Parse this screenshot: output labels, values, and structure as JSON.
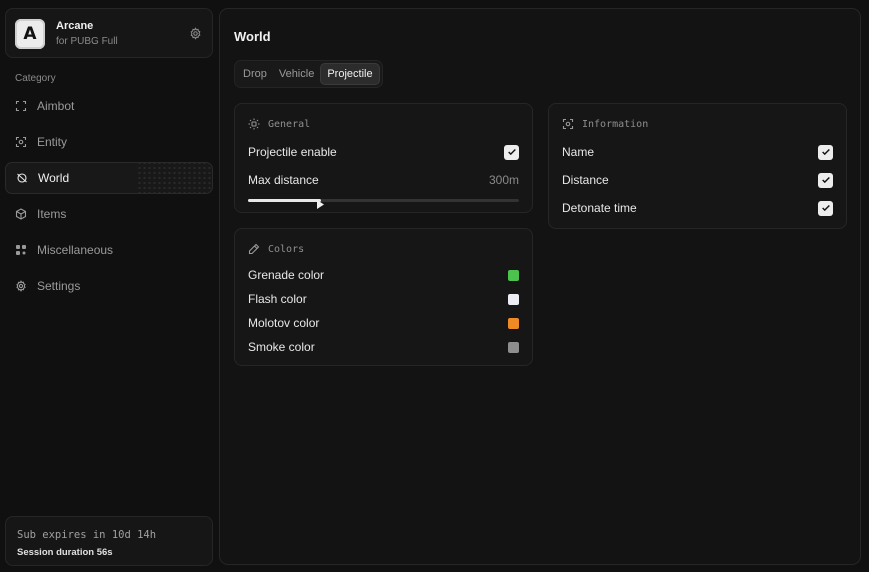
{
  "brand": {
    "logo_letter": "A",
    "name": "Arcane",
    "subtitle": "for PUBG Full",
    "icon": "gear-icon"
  },
  "sidebar": {
    "category_label": "Category",
    "items": [
      {
        "label": "Aimbot",
        "icon": "crosshair-icon",
        "active": false
      },
      {
        "label": "Entity",
        "icon": "scan-icon",
        "active": false
      },
      {
        "label": "World",
        "icon": "globe-icon",
        "active": true
      },
      {
        "label": "Items",
        "icon": "cube-icon",
        "active": false
      },
      {
        "label": "Miscellaneous",
        "icon": "grid-icon",
        "active": false
      },
      {
        "label": "Settings",
        "icon": "gear-icon",
        "active": false
      }
    ],
    "subscription": {
      "expires": "Sub expires in 10d 14h",
      "session": "Session duration 56s"
    }
  },
  "main": {
    "title": "World",
    "tabs": [
      {
        "label": "Drop",
        "active": false
      },
      {
        "label": "Vehicle",
        "active": false
      },
      {
        "label": "Projectile",
        "active": true
      }
    ],
    "general": {
      "header": "General",
      "projectile_enable": {
        "label": "Projectile enable",
        "checked": true
      },
      "max_distance": {
        "label": "Max distance",
        "value_text": "300m",
        "fraction": 0.27
      }
    },
    "information": {
      "header": "Information",
      "items": [
        {
          "label": "Name",
          "checked": true
        },
        {
          "label": "Distance",
          "checked": true
        },
        {
          "label": "Detonate time",
          "checked": true
        }
      ]
    },
    "colors": {
      "header": "Colors",
      "items": [
        {
          "label": "Grenade color",
          "color": "#4cc34c"
        },
        {
          "label": "Flash color",
          "color": "#ececf4"
        },
        {
          "label": "Molotov color",
          "color": "#f08a24"
        },
        {
          "label": "Smoke color",
          "color": "#8e8e8e"
        }
      ]
    }
  }
}
